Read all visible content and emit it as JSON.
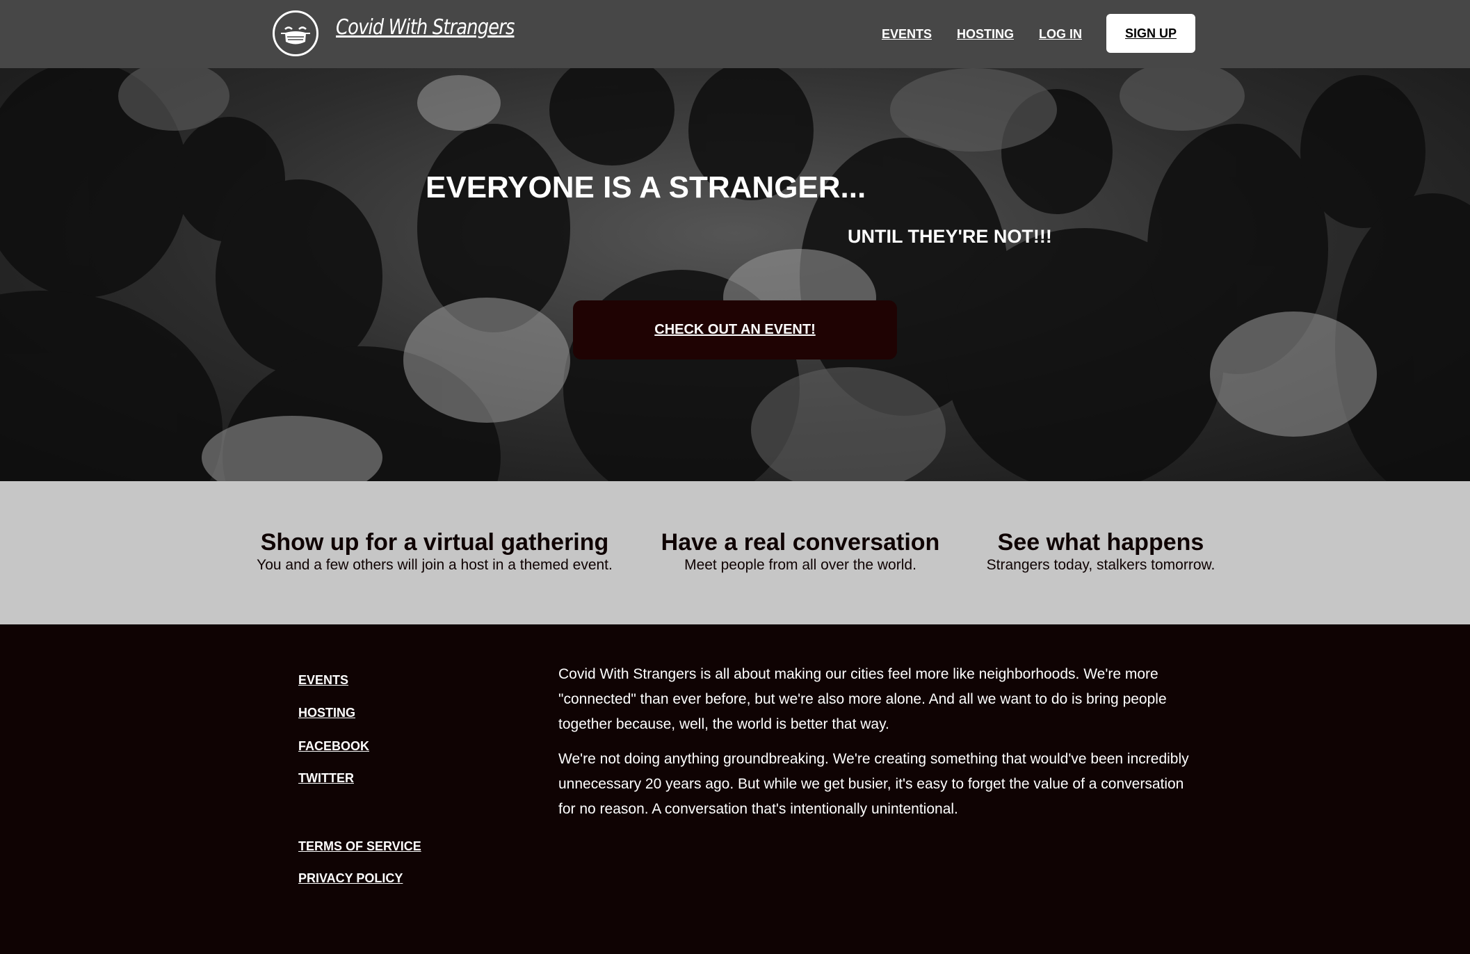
{
  "nav": {
    "brand": "Covid With Strangers",
    "logo_icon": "masked-face-icon",
    "links": [
      {
        "label": "EVENTS"
      },
      {
        "label": "HOSTING"
      },
      {
        "label": "LOG IN"
      }
    ],
    "signup_label": "SIGN UP"
  },
  "hero": {
    "title": "EVERYONE IS A STRANGER...",
    "subtitle": "UNTIL THEY'RE NOT!!!",
    "cta_label": "CHECK OUT AN EVENT!"
  },
  "features": [
    {
      "heading": "Show up for a virtual gathering",
      "text": "You and a few others will join a host in a themed event."
    },
    {
      "heading": "Have a real conversation",
      "text": "Meet people from all over the world."
    },
    {
      "heading": "See what happens",
      "text": "Strangers today, stalkers tomorrow."
    }
  ],
  "footer": {
    "links": [
      {
        "label": "EVENTS"
      },
      {
        "label": "HOSTING"
      },
      {
        "label": "FACEBOOK"
      },
      {
        "label": "TWITTER"
      }
    ],
    "legal": [
      {
        "label": "TERMS OF SERVICE"
      },
      {
        "label": "PRIVACY POLICY"
      }
    ],
    "about": [
      "Covid With Strangers is all about making our cities feel more like neighborhoods. We're more \"connected\" than ever before, but we're also more alone. And all we want to do is bring people together because, well, the world is better that way.",
      "We're not doing anything groundbreaking. We're creating something that would've been incredibly unnecessary 20 years ago. But while we get busier, it's easy to forget the value of a conversation for no reason. A conversation that's intentionally unintentional."
    ]
  },
  "colors": {
    "navbar": "#474747",
    "features_bg": "#c6c6c6",
    "footer_bg": "#0f0303",
    "cta_bg": "#1f0303",
    "signup_bg": "#ffffff"
  }
}
